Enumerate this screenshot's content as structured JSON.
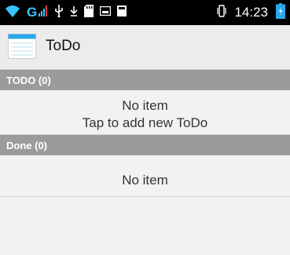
{
  "status_bar": {
    "network": "G",
    "time": "14:23",
    "icons": [
      "wifi-icon",
      "signal-icon",
      "usb-icon",
      "download-icon",
      "sd-card-icon",
      "image-icon",
      "storage-icon",
      "vibrate-icon",
      "battery-icon"
    ]
  },
  "app_bar": {
    "title": "ToDo",
    "icon": "app-notepad-icon"
  },
  "sections": {
    "todo": {
      "header": "TODO (0)",
      "empty_line1": "No item",
      "empty_line2": "Tap to add new ToDo"
    },
    "done": {
      "header": "Done (0)",
      "empty_line1": "No item"
    }
  },
  "colors": {
    "status_bar": "#000000",
    "accent_blue": "#2aa7ea",
    "section_header": "#9b9b9b",
    "background": "#f2f2f2"
  }
}
